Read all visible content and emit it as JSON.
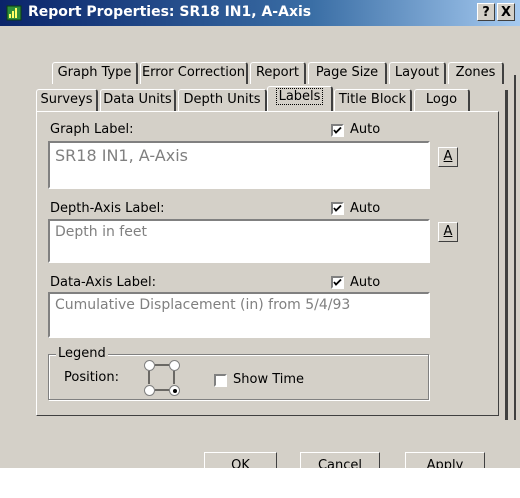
{
  "window": {
    "title": "Report Properties: SR18 IN1, A-Axis",
    "help_button": "?",
    "close_button": "X"
  },
  "tabs": {
    "back_row": [
      "Graph Type",
      "Error Correction",
      "Report",
      "Page Size",
      "Layout",
      "Zones"
    ],
    "front_row": [
      "Surveys",
      "Data Units",
      "Depth Units",
      "Labels",
      "Title Block",
      "Logo"
    ],
    "selected": "Labels"
  },
  "graph_label": {
    "label": "Graph Label:",
    "auto_label": "Auto",
    "auto_checked": true,
    "value": "SR18 IN1, A-Axis",
    "font_button": "A"
  },
  "depth_axis_label": {
    "label": "Depth-Axis Label:",
    "auto_label": "Auto",
    "auto_checked": true,
    "value": "Depth in feet",
    "font_button": "A"
  },
  "data_axis_label": {
    "label": "Data-Axis Label:",
    "auto_label": "Auto",
    "auto_checked": true,
    "value": "Cumulative Displacement (in) from 5/4/93"
  },
  "legend": {
    "group_label": "Legend",
    "position_label": "Position:",
    "selected_position": "bottom-right",
    "show_time_label": "Show Time",
    "show_time_checked": false
  },
  "buttons": {
    "ok": "OK",
    "cancel": "Cancel",
    "apply": "Apply"
  }
}
